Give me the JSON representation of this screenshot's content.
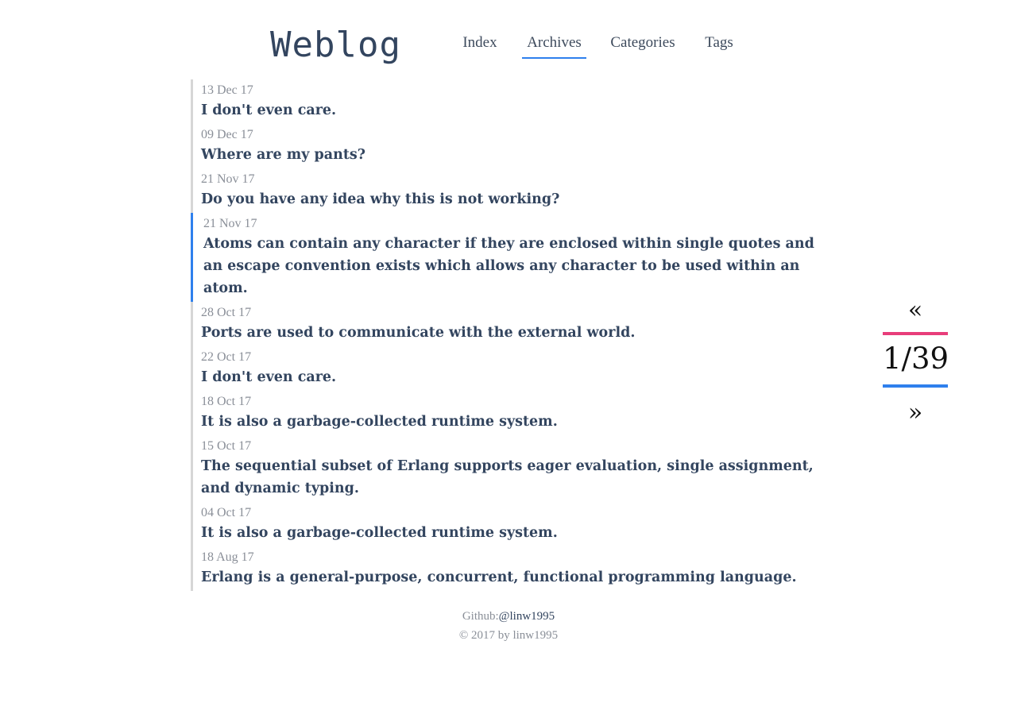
{
  "site": {
    "logo": "Weblog"
  },
  "nav": {
    "items": [
      {
        "label": "Index"
      },
      {
        "label": "Archives",
        "active": true
      },
      {
        "label": "Categories"
      },
      {
        "label": "Tags"
      }
    ]
  },
  "archive": {
    "posts": [
      {
        "date": "13 Dec 17",
        "title": "I don't even care."
      },
      {
        "date": "09 Dec 17",
        "title": "Where are my pants?"
      },
      {
        "date": "21 Nov 17",
        "title": "Do you have any idea why this is not working?"
      },
      {
        "date": "21 Nov 17",
        "title": "Atoms can contain any character if they are enclosed within single quotes and an escape convention exists which allows any character to be used within an atom."
      },
      {
        "date": "28 Oct 17",
        "title": "Ports are used to communicate with the external world."
      },
      {
        "date": "22 Oct 17",
        "title": "I don't even care."
      },
      {
        "date": "18 Oct 17",
        "title": "It is also a garbage-collected runtime system."
      },
      {
        "date": "15 Oct 17",
        "title": "The sequential subset of Erlang supports eager evaluation, single assignment, and dynamic typing."
      },
      {
        "date": "04 Oct 17",
        "title": "It is also a garbage-collected runtime system."
      },
      {
        "date": "18 Aug 17",
        "title": "Erlang is a general-purpose, concurrent, functional programming language."
      }
    ]
  },
  "pager": {
    "prev_label": "«",
    "current": "1/39",
    "next_label": "»"
  },
  "footer": {
    "github_prefix": "Github:",
    "github_handle": "@linw1995",
    "copyright": "© 2017 by linw1995"
  },
  "colors": {
    "text": "#33455f",
    "muted": "#8a8f98",
    "accent_blue": "#2f80ed",
    "accent_pink": "#e83e7a",
    "rule_gray": "#d6d6d6"
  }
}
